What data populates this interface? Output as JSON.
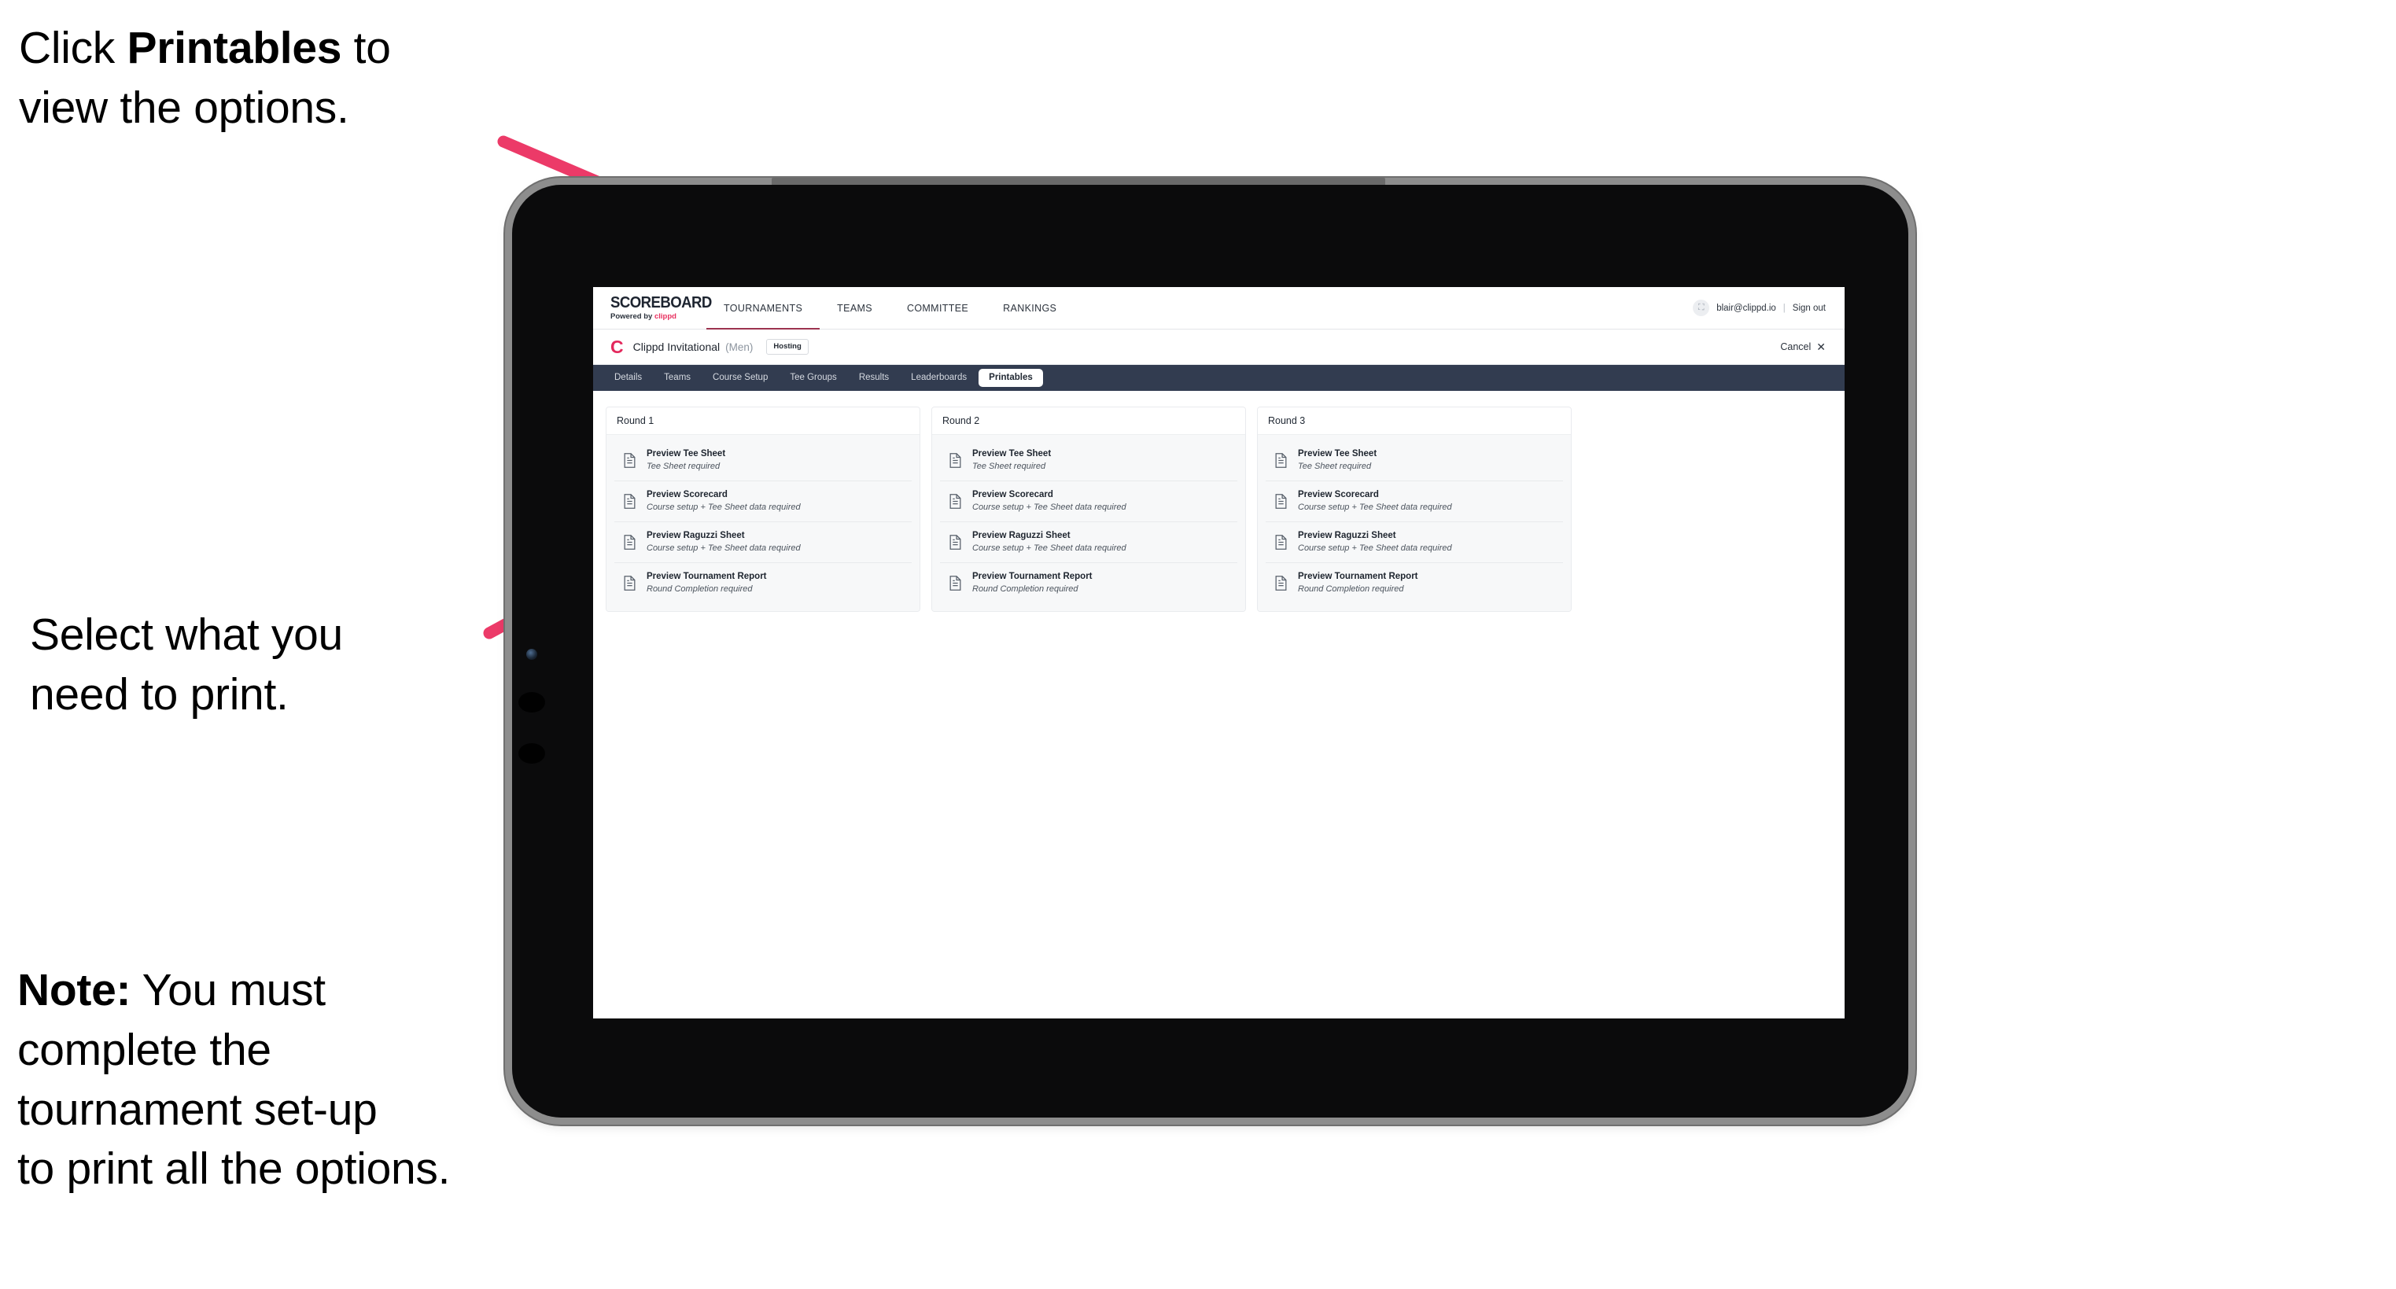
{
  "annotations": {
    "callout_1": {
      "before": "Click ",
      "bold": "Printables",
      "after": " to\nview the options."
    },
    "callout_2": {
      "text": "Select what you\n need to print."
    },
    "callout_3": {
      "bold": "Note:",
      "after": " You must\ncomplete the\ntournament set-up\nto print all the options."
    }
  },
  "colors": {
    "accent_pink": "#ec3a68",
    "brand_red": "#e3285c",
    "tab_strip_dark": "#323c50",
    "nav_underline": "#9c3350",
    "card_bg": "#f7f8f9"
  },
  "app": {
    "brand": {
      "title": "SCOREBOARD",
      "powered_prefix": "Powered by ",
      "powered_brand": "clippd"
    },
    "nav": [
      {
        "label": "TOURNAMENTS",
        "active": true
      },
      {
        "label": "TEAMS",
        "active": false
      },
      {
        "label": "COMMITTEE",
        "active": false
      },
      {
        "label": "RANKINGS",
        "active": false
      }
    ],
    "header_right": {
      "avatar_glyph": "⛶",
      "email": "blair@clippd.io",
      "divider": "|",
      "sign_out": "Sign out"
    },
    "tournament": {
      "logo_glyph": "C",
      "name": "Clippd Invitational",
      "gender": "(Men)",
      "status_badge": "Hosting",
      "cancel_label": "Cancel",
      "cancel_glyph": "✕"
    },
    "tabs": [
      {
        "label": "Details",
        "active": false
      },
      {
        "label": "Teams",
        "active": false
      },
      {
        "label": "Course Setup",
        "active": false
      },
      {
        "label": "Tee Groups",
        "active": false
      },
      {
        "label": "Results",
        "active": false
      },
      {
        "label": "Leaderboards",
        "active": false
      },
      {
        "label": "Printables",
        "active": true
      }
    ],
    "rounds": [
      {
        "header": "Round 1",
        "items": [
          {
            "title": "Preview Tee Sheet",
            "subtitle": "Tee Sheet required"
          },
          {
            "title": "Preview Scorecard",
            "subtitle": "Course setup + Tee Sheet data required"
          },
          {
            "title": "Preview Raguzzi Sheet",
            "subtitle": "Course setup + Tee Sheet data required"
          },
          {
            "title": "Preview Tournament Report",
            "subtitle": "Round Completion required"
          }
        ]
      },
      {
        "header": "Round 2",
        "items": [
          {
            "title": "Preview Tee Sheet",
            "subtitle": "Tee Sheet required"
          },
          {
            "title": "Preview Scorecard",
            "subtitle": "Course setup + Tee Sheet data required"
          },
          {
            "title": "Preview Raguzzi Sheet",
            "subtitle": "Course setup + Tee Sheet data required"
          },
          {
            "title": "Preview Tournament Report",
            "subtitle": "Round Completion required"
          }
        ]
      },
      {
        "header": "Round 3",
        "items": [
          {
            "title": "Preview Tee Sheet",
            "subtitle": "Tee Sheet required"
          },
          {
            "title": "Preview Scorecard",
            "subtitle": "Course setup + Tee Sheet data required"
          },
          {
            "title": "Preview Raguzzi Sheet",
            "subtitle": "Course setup + Tee Sheet data required"
          },
          {
            "title": "Preview Tournament Report",
            "subtitle": "Round Completion required"
          }
        ]
      }
    ]
  }
}
